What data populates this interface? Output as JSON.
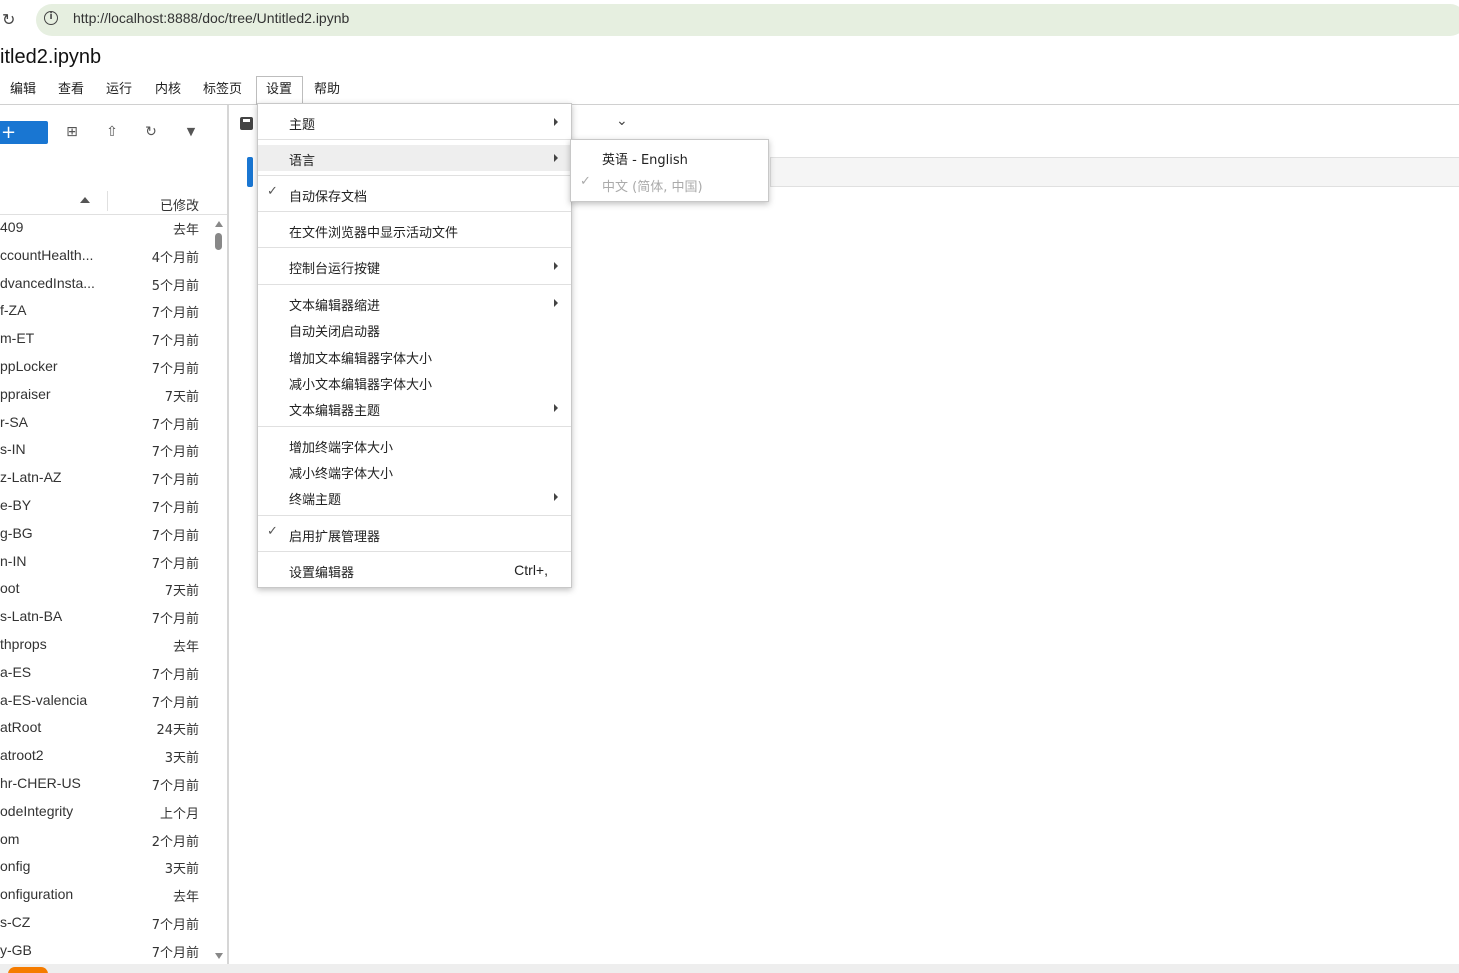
{
  "browser": {
    "url": "http://localhost:8888/doc/tree/Untitled2.ipynb",
    "reload_icon": "↻",
    "info_icon": "i"
  },
  "document": {
    "title": "itled2.ipynb"
  },
  "menubar": {
    "items": [
      "编辑",
      "查看",
      "运行",
      "内核",
      "标签页",
      "设置",
      "帮助"
    ],
    "active": "设置"
  },
  "file_browser": {
    "new_button_label": "+",
    "header_modified": "已修改",
    "files": [
      {
        "name": "409",
        "modified": "去年"
      },
      {
        "name": "ccountHealth...",
        "modified": "4个月前"
      },
      {
        "name": "dvancedInsta...",
        "modified": "5个月前"
      },
      {
        "name": "f-ZA",
        "modified": "7个月前"
      },
      {
        "name": "m-ET",
        "modified": "7个月前"
      },
      {
        "name": "ppLocker",
        "modified": "7个月前"
      },
      {
        "name": "ppraiser",
        "modified": "7天前"
      },
      {
        "name": "r-SA",
        "modified": "7个月前"
      },
      {
        "name": "s-IN",
        "modified": "7个月前"
      },
      {
        "name": "z-Latn-AZ",
        "modified": "7个月前"
      },
      {
        "name": "e-BY",
        "modified": "7个月前"
      },
      {
        "name": "g-BG",
        "modified": "7个月前"
      },
      {
        "name": "n-IN",
        "modified": "7个月前"
      },
      {
        "name": "oot",
        "modified": "7天前"
      },
      {
        "name": "s-Latn-BA",
        "modified": "7个月前"
      },
      {
        "name": "thprops",
        "modified": "去年"
      },
      {
        "name": "a-ES",
        "modified": "7个月前"
      },
      {
        "name": "a-ES-valencia",
        "modified": "7个月前"
      },
      {
        "name": "atRoot",
        "modified": "24天前"
      },
      {
        "name": "atroot2",
        "modified": "3天前"
      },
      {
        "name": "hr-CHER-US",
        "modified": "7个月前"
      },
      {
        "name": "odeIntegrity",
        "modified": "上个月"
      },
      {
        "name": "om",
        "modified": "2个月前"
      },
      {
        "name": "onfig",
        "modified": "3天前"
      },
      {
        "name": "onfiguration",
        "modified": "去年"
      },
      {
        "name": "s-CZ",
        "modified": "7个月前"
      },
      {
        "name": "y-GB",
        "modified": "7个月前"
      }
    ]
  },
  "settings_menu": {
    "theme": "主题",
    "language": "语言",
    "autosave": "自动保存文档",
    "show_active_file": "在文件浏览器中显示活动文件",
    "console_run_keys": "控制台运行按键",
    "editor_indent": "文本编辑器缩进",
    "auto_close_brackets": "自动关闭启动器",
    "increase_editor_font": "增加文本编辑器字体大小",
    "decrease_editor_font": "减小文本编辑器字体大小",
    "editor_theme": "文本编辑器主题",
    "increase_terminal_font": "增加终端字体大小",
    "decrease_terminal_font": "减小终端字体大小",
    "terminal_theme": "终端主题",
    "enable_extension_manager": "启用扩展管理器",
    "settings_editor": "设置编辑器",
    "settings_editor_shortcut": "Ctrl+,",
    "check_mark": "✓"
  },
  "language_submenu": {
    "english": "英语 - English",
    "chinese": "中文 (简体, 中国)",
    "check_mark": "✓"
  },
  "toolbar_icons": {
    "new_folder": "⊞",
    "upload": "⇧",
    "refresh": "↻",
    "filter": "▼",
    "kernel_chevron": "⌄"
  }
}
